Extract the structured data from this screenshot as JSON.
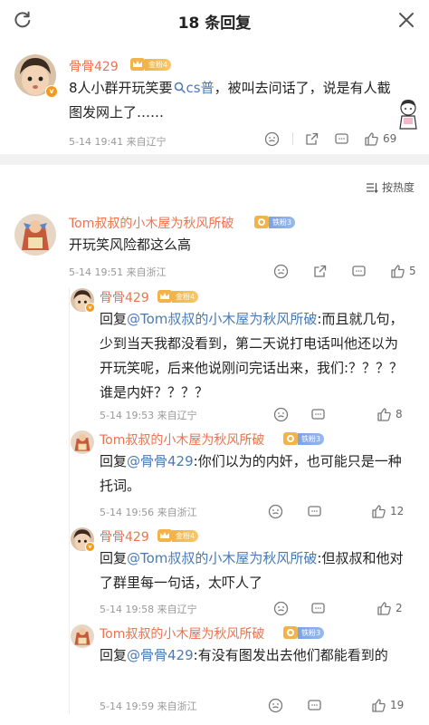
{
  "header": {
    "title": "18 条回复"
  },
  "main": {
    "username": "骨骨429",
    "badge": "金粉4",
    "text_pre": "8人小群开玩笑要",
    "link": "cs普",
    "text_post": "，被叫去问话了，说是有人截图发网上了……",
    "meta": "5-14 19:41  来自辽宁",
    "likes": "69"
  },
  "sort": {
    "label": "按热度"
  },
  "reply1": {
    "username": "Tom叔叔的小木屋为秋风所破",
    "badge": "铁粉3",
    "text": "开玩笑风险都这么高",
    "meta": "5-14 19:51  来自浙江",
    "likes": "5"
  },
  "subreplies": [
    {
      "username": "骨骨429",
      "badge": "金粉4",
      "prefix": "回复",
      "mention": "@Tom叔叔的小木屋为秋风所破",
      "text": ":而且就几句，少到当天我都没看到，第二天说打电话叫他还以为开玩笑呢，后来他说刚问完话出来，我们:？？？？ 谁是内奸？？？？",
      "meta": "5-14 19:53  来自辽宁",
      "likes": "8"
    },
    {
      "username": "Tom叔叔的小木屋为秋风所破",
      "badge": "铁粉3",
      "prefix": "回复",
      "mention": "@骨骨429",
      "text": ":你们以为的内奸，也可能只是一种托词。",
      "meta": "5-14 19:56  来自浙江",
      "likes": "12"
    },
    {
      "username": "骨骨429",
      "badge": "金粉4",
      "prefix": "回复",
      "mention": "@Tom叔叔的小木屋为秋风所破",
      "text": ":但叔叔和他对了群里每一句话，太吓人了",
      "meta": "5-14 19:58  来自辽宁",
      "likes": "2"
    },
    {
      "username": "Tom叔叔的小木屋为秋风所破",
      "badge": "铁粉3",
      "prefix": "回复",
      "mention": "@骨骨429",
      "text": ":有没有图发出去他们都能看到的",
      "meta": "5-14 19:59  来自浙江",
      "likes": "19"
    }
  ]
}
